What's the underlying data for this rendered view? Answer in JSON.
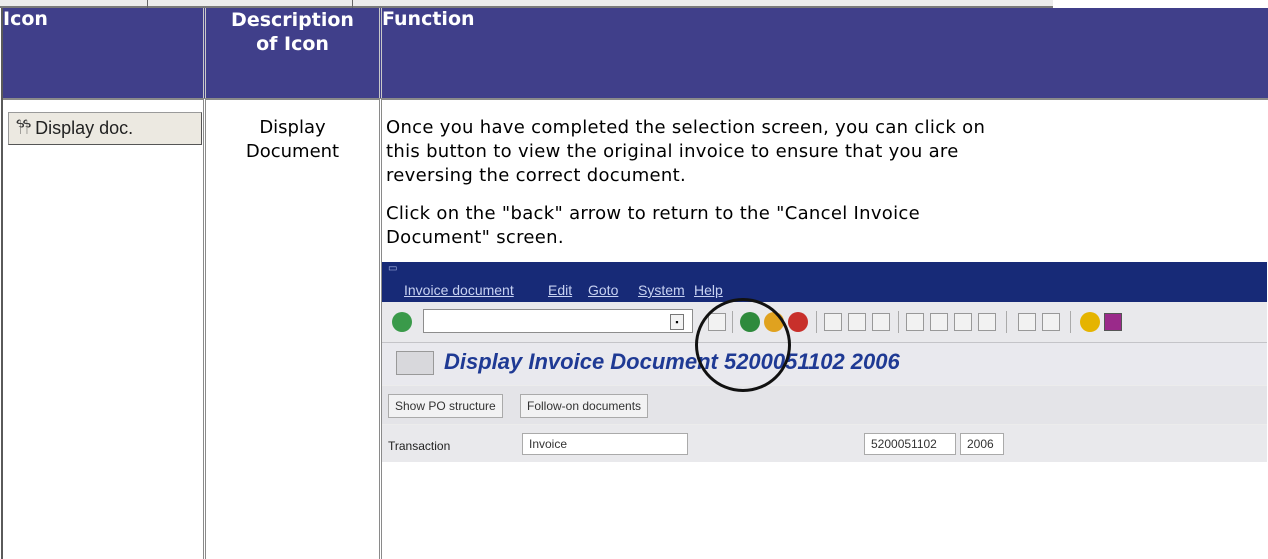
{
  "header": {
    "col1": "Icon",
    "col2_line1": "Description",
    "col2_line2": "of Icon",
    "col3": "Function"
  },
  "row": {
    "button_label": "Display doc.",
    "button_icon": "glasses-icon",
    "description_line1": "Display",
    "description_line2": "Document",
    "para1_line1": "Once you have completed the selection screen, you can click on",
    "para1_line2": "this button to view the original invoice to ensure that you are",
    "para1_line3": "reversing the correct document.",
    "para2_line1": "Click on the \"back\" arrow to return to the \"Cancel Invoice",
    "para2_line2": "Document\" screen."
  },
  "sap_screenshot": {
    "menu": [
      "Invoice document",
      "Edit",
      "Goto",
      "System",
      "Help"
    ],
    "title": "Display Invoice Document 5200051102 2006",
    "buttons": [
      "Show PO structure",
      "Follow-on documents"
    ],
    "field_label": "Transaction",
    "field_value": "Invoice",
    "doc_number": "5200051102",
    "year": "2006"
  },
  "colors": {
    "header_bg": "#403f8a",
    "sap_menu_bg": "#172a77",
    "sap_title": "#1f3a94"
  }
}
